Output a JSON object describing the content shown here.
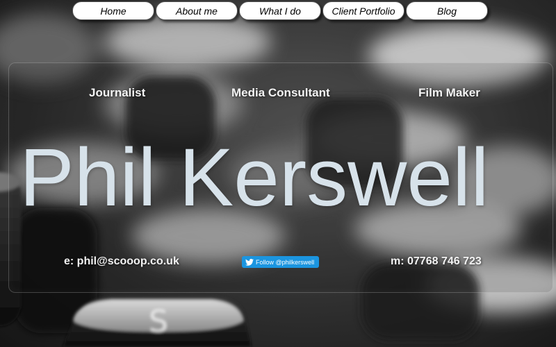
{
  "nav": {
    "items": [
      {
        "label": "Home"
      },
      {
        "label": "About me"
      },
      {
        "label": "What I do"
      },
      {
        "label": "Client Portfolio"
      },
      {
        "label": "Blog"
      }
    ]
  },
  "hero": {
    "roles": [
      "Journalist",
      "Media Consultant",
      "Film Maker"
    ],
    "name": "Phil Kerswell",
    "email": "e: phil@scooop.co.uk",
    "twitter_label": "Follow @philkerswell",
    "phone": "m: 07768 746 723"
  },
  "icons": {
    "twitter": "twitter-bird-icon"
  },
  "colors": {
    "twitter_blue": "#1b95e0",
    "name_text": "#d7e2ea",
    "nav_bg": "#ffffff"
  }
}
